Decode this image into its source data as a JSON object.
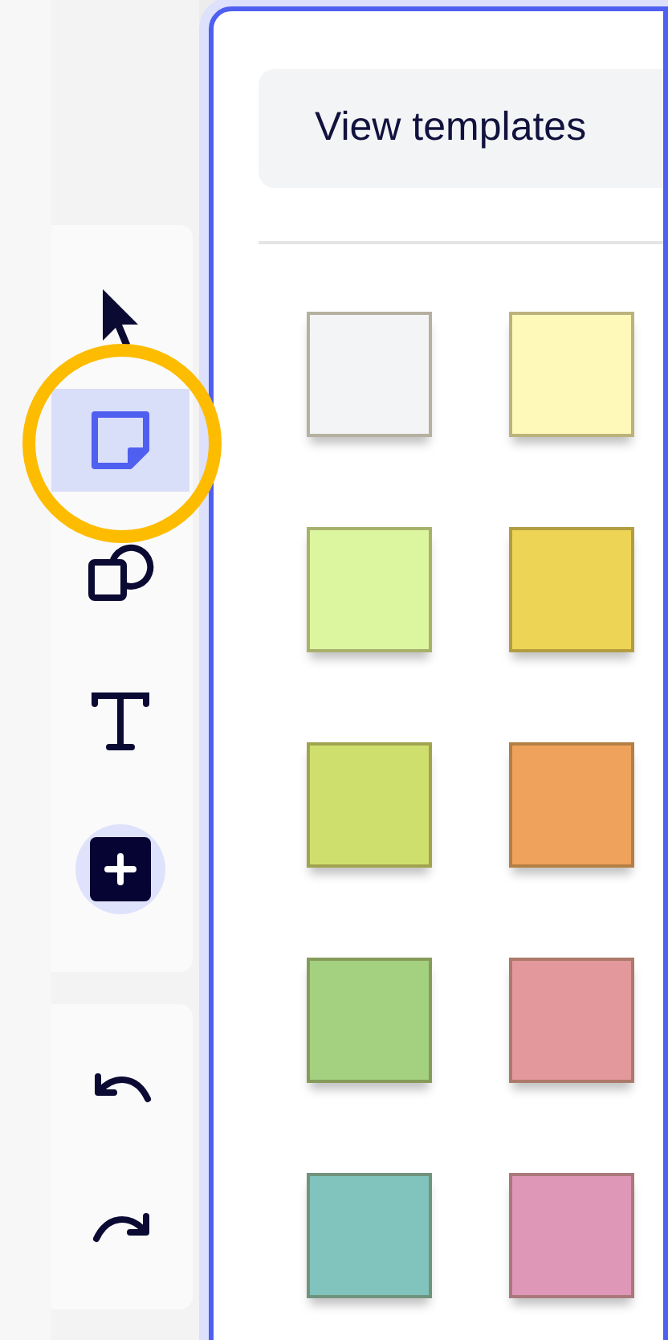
{
  "tools": [
    {
      "kind": "cursor",
      "selected": false
    },
    {
      "kind": "sticky",
      "selected": true
    },
    {
      "kind": "shapes",
      "selected": false
    },
    {
      "kind": "text",
      "selected": false
    },
    {
      "kind": "add",
      "selected": false
    }
  ],
  "history": [
    {
      "kind": "undo"
    },
    {
      "kind": "redo"
    }
  ],
  "panel": {
    "button": "View templates",
    "swatches": [
      {
        "color": "#f3f4f6"
      },
      {
        "color": "#fef8b9"
      },
      {
        "color": "#dcf59f"
      },
      {
        "color": "#eed455"
      },
      {
        "color": "#cfdf6e"
      },
      {
        "color": "#efa25c"
      },
      {
        "color": "#a3d180"
      },
      {
        "color": "#e3999b"
      },
      {
        "color": "#80c4bd"
      },
      {
        "color": "#df97b8"
      }
    ]
  }
}
